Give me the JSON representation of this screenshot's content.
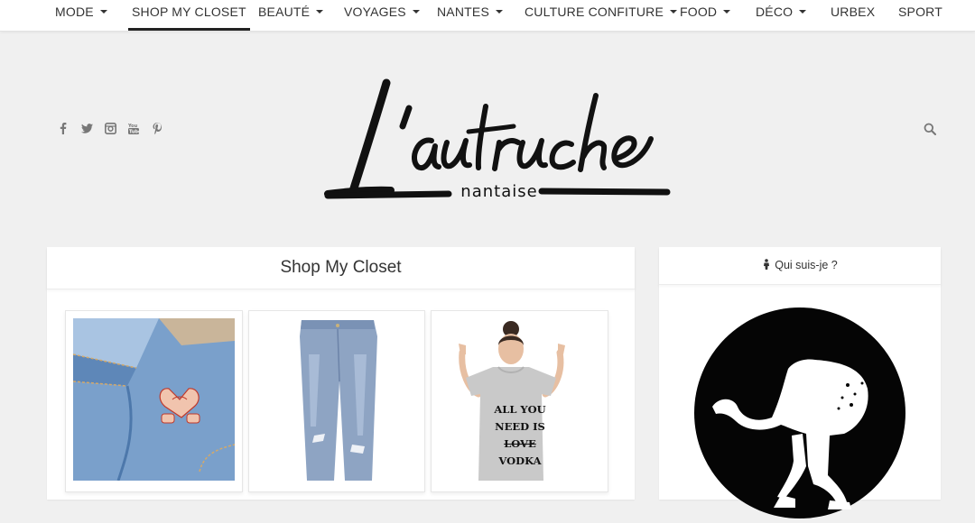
{
  "nav": {
    "items": [
      {
        "label": "MODE",
        "dropdown": true
      },
      {
        "label": "SHOP MY CLOSET",
        "dropdown": false,
        "active": true
      },
      {
        "label": "BEAUTÉ",
        "dropdown": true
      },
      {
        "label": "VOYAGES",
        "dropdown": true
      },
      {
        "label": "NANTES",
        "dropdown": true
      },
      {
        "label": "CULTURE CONFITURE",
        "dropdown": true
      },
      {
        "label": "FOOD",
        "dropdown": true
      },
      {
        "label": "DÉCO",
        "dropdown": true
      },
      {
        "label": "URBEX",
        "dropdown": false
      },
      {
        "label": "SPORT",
        "dropdown": false
      }
    ]
  },
  "header": {
    "social": [
      "facebook-icon",
      "twitter-icon",
      "instagram-icon",
      "youtube-icon",
      "pinterest-icon"
    ],
    "logo_title": "L'autruche",
    "logo_subtitle": "nantaise"
  },
  "main": {
    "title": "Shop My Closet",
    "products": [
      {
        "image": "denim-jacket-with-heart-hands-pin"
      },
      {
        "image": "light-wash-ripped-jeans"
      },
      {
        "image": "grey-tshirt-all-you-need-is-vodka",
        "shirt_text": [
          "ALL YOU",
          "NEED IS",
          "LOVE",
          "VODKA"
        ]
      }
    ]
  },
  "sidebar": {
    "title": "Qui suis-je ?",
    "title_icon": "person-icon",
    "avatar": "ostrich-silhouette-avatar"
  },
  "colors": {
    "background": "#f0f0f0",
    "panel": "#ffffff",
    "text": "#222222",
    "logo": "#111111",
    "active_underline": "#222222"
  }
}
